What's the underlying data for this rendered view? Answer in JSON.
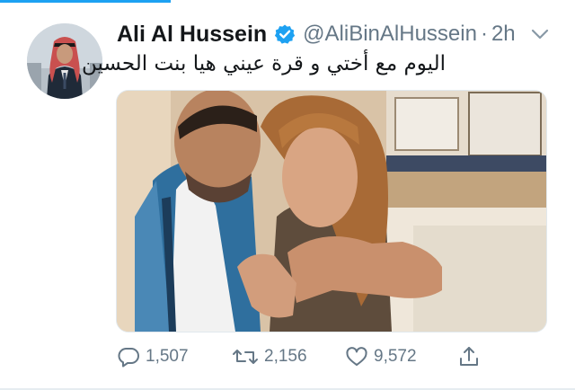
{
  "tweet": {
    "author_name": "Ali Al Hussein",
    "handle": "@AliBinAlHussein",
    "separator": "·",
    "time": "2h",
    "text": "اليوم مع أختي و قرة عيني هيا بنت الحسين"
  },
  "actions": {
    "reply_count": "1,507",
    "retweet_count": "2,156",
    "like_count": "9,572"
  },
  "icons": {
    "verified": "verified-badge-icon",
    "caret": "chevron-down-icon",
    "reply": "reply-icon",
    "retweet": "retweet-icon",
    "like": "heart-icon",
    "share": "share-icon"
  },
  "colors": {
    "accent": "#1da1f2",
    "text": "#14171a",
    "secondary": "#657786"
  }
}
